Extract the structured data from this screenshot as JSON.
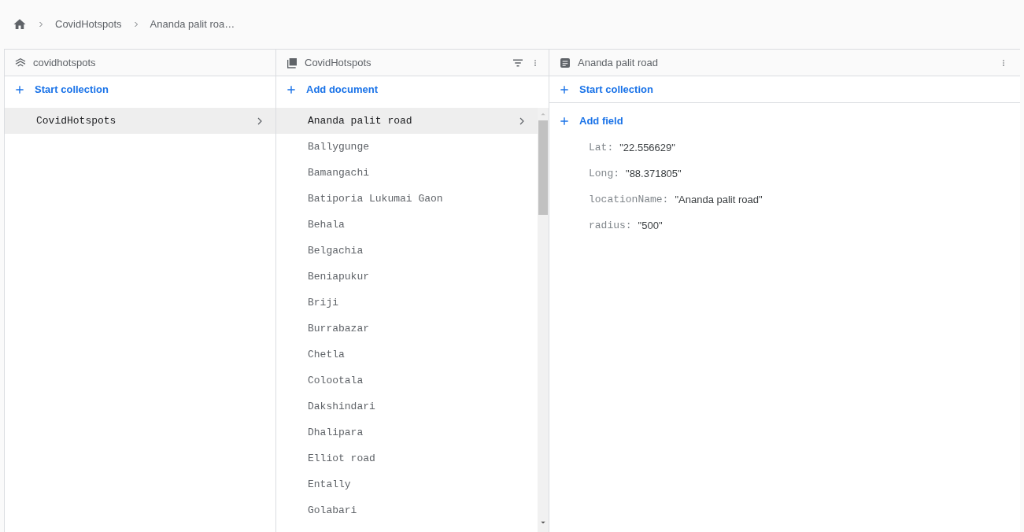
{
  "breadcrumb": [
    "CovidHotspots",
    "Ananda palit roa…"
  ],
  "root_panel": {
    "title": "covidhotspots",
    "action": "Start collection",
    "items": [
      {
        "label": "CovidHotspots",
        "selected": true
      }
    ]
  },
  "collection_panel": {
    "title": "CovidHotspots",
    "action": "Add document",
    "items": [
      {
        "label": "Ananda palit road",
        "selected": true
      },
      {
        "label": "Ballygunge",
        "selected": false
      },
      {
        "label": "Bamangachi",
        "selected": false
      },
      {
        "label": "Batiporia Lukumai Gaon",
        "selected": false
      },
      {
        "label": "Behala",
        "selected": false
      },
      {
        "label": "Belgachia",
        "selected": false
      },
      {
        "label": "Beniapukur",
        "selected": false
      },
      {
        "label": "Briji",
        "selected": false
      },
      {
        "label": "Burrabazar",
        "selected": false
      },
      {
        "label": "Chetla",
        "selected": false
      },
      {
        "label": "Colootala",
        "selected": false
      },
      {
        "label": "Dakshindari",
        "selected": false
      },
      {
        "label": "Dhalipara",
        "selected": false
      },
      {
        "label": "Elliot road",
        "selected": false
      },
      {
        "label": "Entally",
        "selected": false
      },
      {
        "label": "Golabari",
        "selected": false
      }
    ]
  },
  "document_panel": {
    "title": "Ananda palit road",
    "action": "Start collection",
    "add_field": "Add field",
    "fields": [
      {
        "key": "Lat:",
        "value": "\"22.556629\""
      },
      {
        "key": "Long:",
        "value": "\"88.371805\""
      },
      {
        "key": "locationName:",
        "value": "\"Ananda palit road\""
      },
      {
        "key": "radius:",
        "value": "\"500\""
      }
    ]
  }
}
